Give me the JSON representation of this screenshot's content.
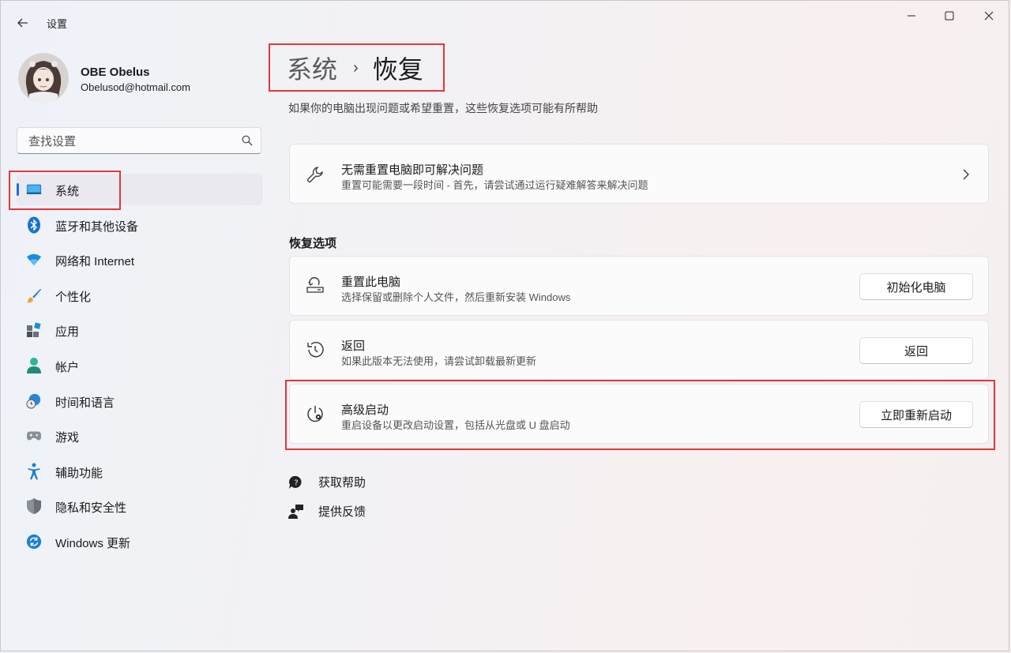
{
  "window": {
    "app_title": "设置",
    "icons": {
      "back": "back-arrow-icon",
      "minimize": "minimize-icon",
      "maximize": "maximize-icon",
      "close": "close-icon"
    }
  },
  "profile": {
    "name": "OBE Obelus",
    "email": "Obelusod@hotmail.com"
  },
  "search": {
    "placeholder": "查找设置"
  },
  "sidebar": {
    "accent_color": "#1f6fcf",
    "items": [
      {
        "label": "系统",
        "icon": "system-display-icon",
        "selected": true
      },
      {
        "label": "蓝牙和其他设备",
        "icon": "bluetooth-icon"
      },
      {
        "label": "网络和 Internet",
        "icon": "wifi-icon"
      },
      {
        "label": "个性化",
        "icon": "brush-icon"
      },
      {
        "label": "应用",
        "icon": "apps-icon"
      },
      {
        "label": "帐户",
        "icon": "account-icon"
      },
      {
        "label": "时间和语言",
        "icon": "time-language-icon"
      },
      {
        "label": "游戏",
        "icon": "gamepad-icon"
      },
      {
        "label": "辅助功能",
        "icon": "accessibility-icon"
      },
      {
        "label": "隐私和安全性",
        "icon": "shield-icon"
      },
      {
        "label": "Windows 更新",
        "icon": "windows-update-icon"
      }
    ]
  },
  "main": {
    "breadcrumb": {
      "parent": "系统",
      "separator": "›",
      "current": "恢复"
    },
    "description": "如果你的电脑出现问题或希望重置，这些恢复选项可能有所帮助",
    "fix_card": {
      "title": "无需重置电脑即可解决问题",
      "subtitle": "重置可能需要一段时间 - 首先，请尝试通过运行疑难解答来解决问题",
      "icon": "wrench-icon"
    },
    "section_title": "恢复选项",
    "options": [
      {
        "title": "重置此电脑",
        "subtitle": "选择保留或删除个人文件，然后重新安装 Windows",
        "button": "初始化电脑",
        "icon": "reset-pc-icon"
      },
      {
        "title": "返回",
        "subtitle": "如果此版本无法使用，请尝试卸载最新更新",
        "button": "返回",
        "icon": "history-icon"
      },
      {
        "title": "高级启动",
        "subtitle": "重启设备以更改启动设置，包括从光盘或 U 盘启动",
        "button": "立即重新启动",
        "icon": "advanced-startup-icon"
      }
    ],
    "links": [
      {
        "label": "获取帮助",
        "icon": "help-chat-icon"
      },
      {
        "label": "提供反馈",
        "icon": "feedback-icon"
      }
    ]
  },
  "highlight_color": "#e0383a"
}
